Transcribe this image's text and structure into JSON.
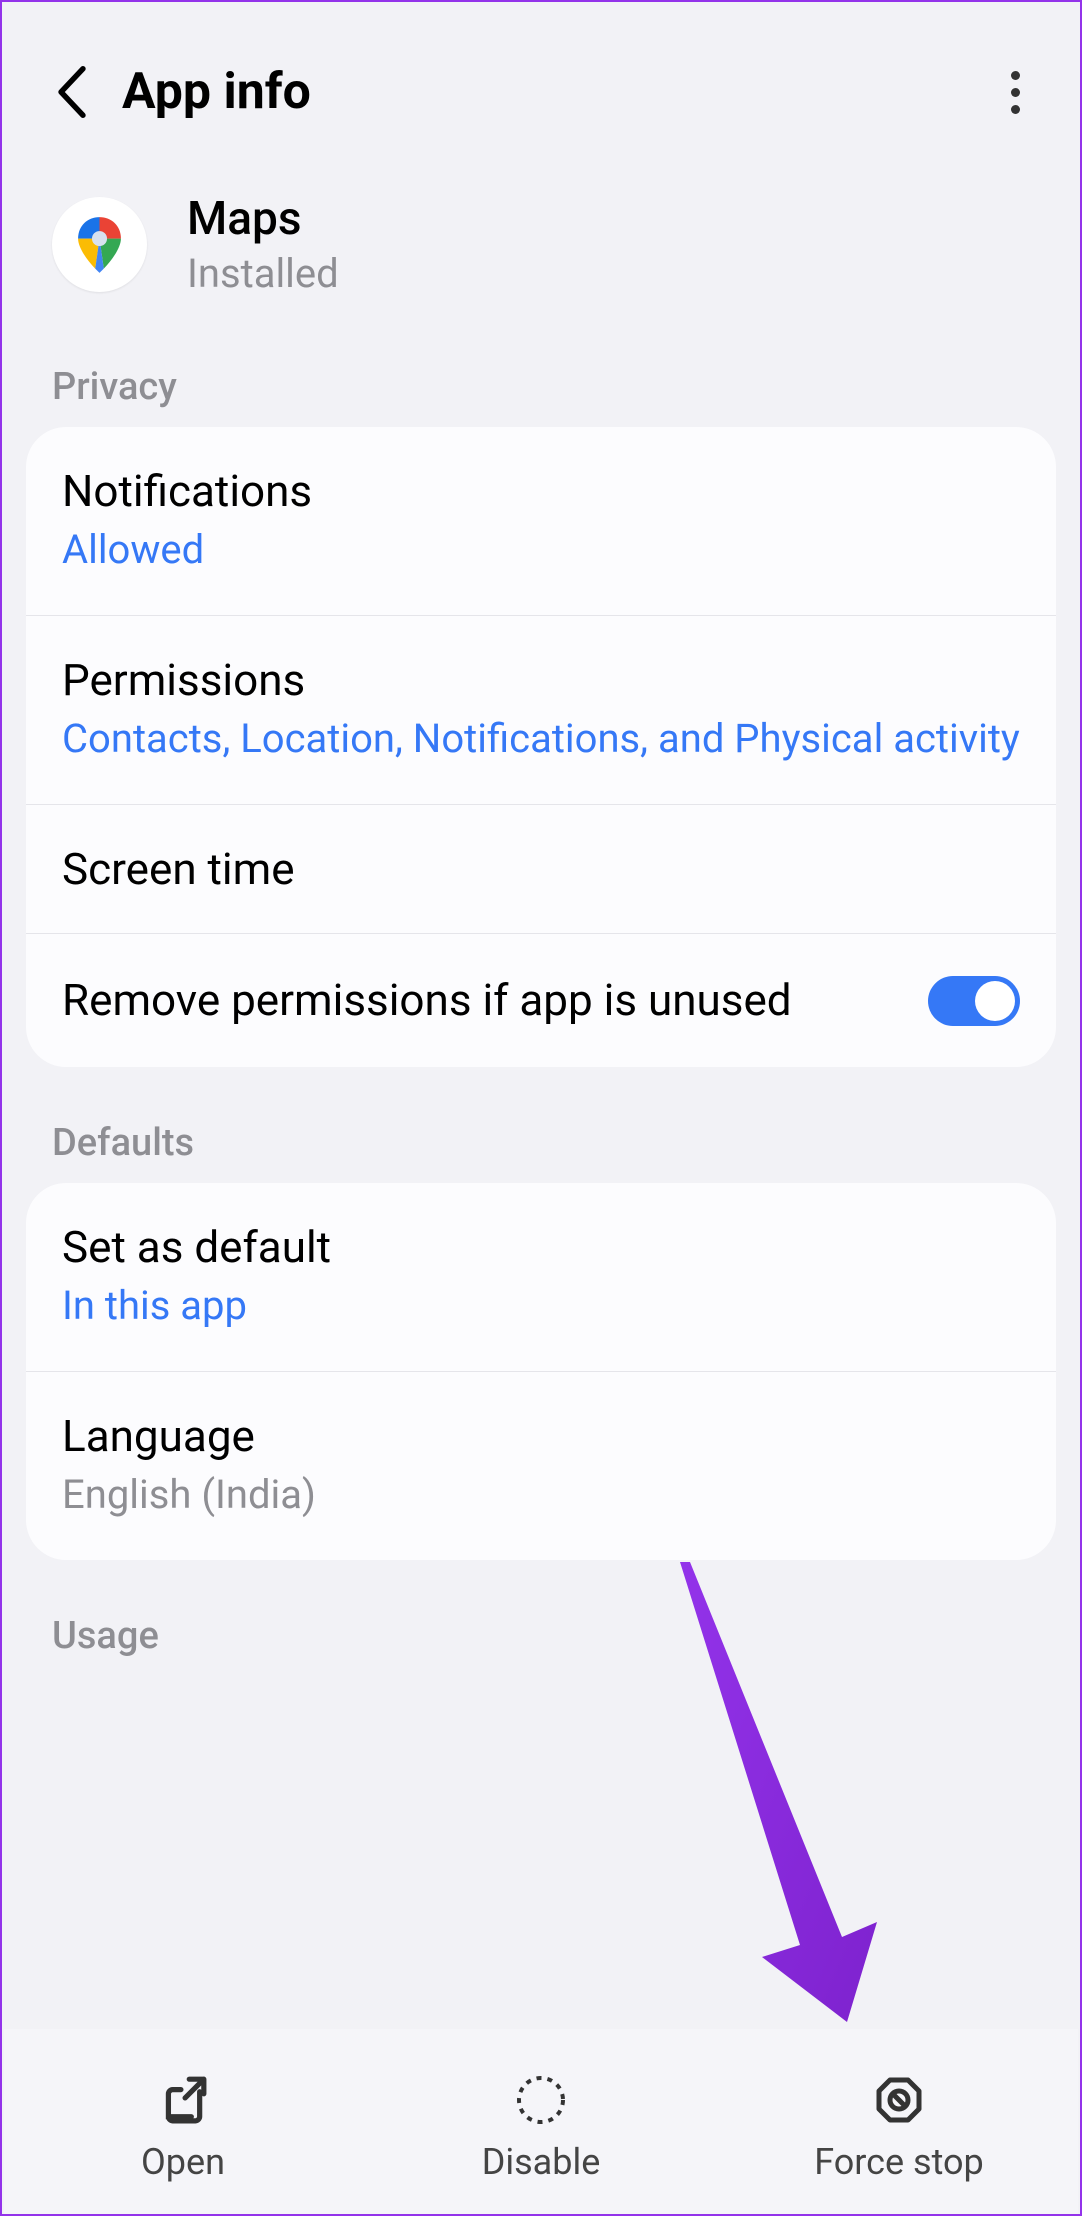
{
  "header": {
    "title": "App info"
  },
  "app": {
    "name": "Maps",
    "status": "Installed"
  },
  "sections": {
    "privacy": {
      "label": "Privacy",
      "notifications": {
        "title": "Notifications",
        "value": "Allowed"
      },
      "permissions": {
        "title": "Permissions",
        "value": "Contacts, Location, Notifications, and Physical activity"
      },
      "screen_time": {
        "title": "Screen time"
      },
      "remove_permissions": {
        "title": "Remove permissions if app is unused"
      }
    },
    "defaults": {
      "label": "Defaults",
      "set_default": {
        "title": "Set as default",
        "value": "In this app"
      },
      "language": {
        "title": "Language",
        "value": "English (India)"
      }
    },
    "usage": {
      "label": "Usage"
    }
  },
  "nav": {
    "open": "Open",
    "disable": "Disable",
    "force_stop": "Force stop"
  }
}
